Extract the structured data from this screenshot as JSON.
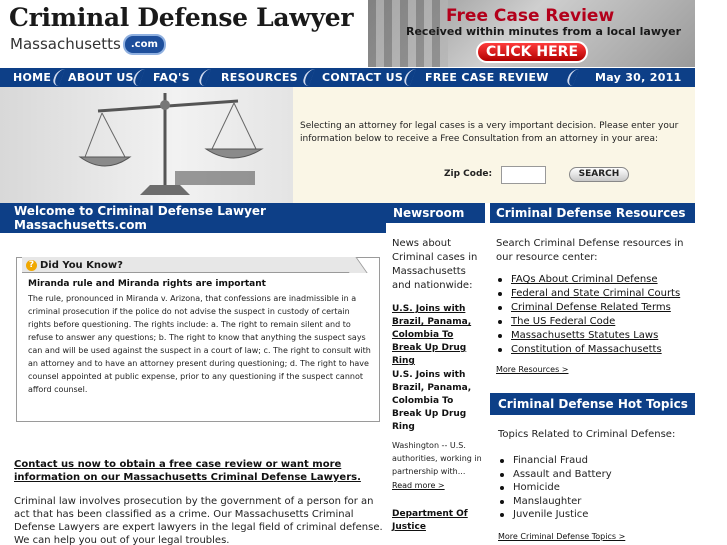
{
  "header": {
    "title": "Criminal Defense Lawyer",
    "subtitle": "Massachusetts",
    "subtitle_badge": ".com"
  },
  "banner": {
    "title": "Free Case Review",
    "subtitle": "Received within minutes from a local lawyer",
    "button": "CLICK HERE"
  },
  "nav": {
    "items": [
      "HOME",
      "ABOUT US",
      "FAQ'S",
      "RESOURCES",
      "CONTACT US",
      "FREE CASE REVIEW"
    ],
    "date": "May 30, 2011"
  },
  "hero": {
    "text": "Selecting an attorney for legal cases is a very important decision. Please enter your information below to receive a Free Consultation from an attorney in your area:",
    "zip_label": "Zip Code:",
    "zip_value": "",
    "search_button": "SEARCH"
  },
  "welcome": {
    "title_line1": "Welcome to Criminal Defense Lawyer",
    "title_line2": "Massachusetts.com"
  },
  "did_you_know": {
    "title": "Did You Know?",
    "icon": "?",
    "heading": "Miranda rule and Miranda rights are important",
    "body": "The rule, pronounced in Miranda v. Arizona, that confessions are inadmissible in a criminal prosecution if the police do not advise the suspect in custody of certain rights before questioning. The rights include: a. The right to remain silent and to refuse to answer any questions; b. The right to know that anything the suspect says can and will be used against the suspect in a court of law; c. The right to consult with an attorney and to have an attorney present during questioning; d. The right to have counsel appointed at public expense, prior to any questioning if the suspect cannot afford counsel."
  },
  "contact": {
    "link": "Contact us now to obtain a free case review or want more information on our Massachusetts Criminal Defense Lawyers.",
    "intro": "Criminal law involves prosecution by the government of a person for an act that has been classified as a crime. Our Massachusetts Criminal Defense Lawyers are expert lawyers in the legal field of criminal defense. We can help you out of your legal troubles."
  },
  "newsroom": {
    "title": "Newsroom",
    "intro": "News about Criminal cases in Massachusetts and nationwide:",
    "items": [
      {
        "link": "U.S. Joins with Brazil, Panama, Colombia To Break Up Drug Ring",
        "title": "U.S. Joins with Brazil, Panama, Colombia To Break Up Drug Ring",
        "desc": "Washington -- U.S. authorities, working in partnership with...",
        "more": "Read more >"
      },
      {
        "link": "Department Of Justice"
      }
    ]
  },
  "resources": {
    "title": "Criminal Defense Resources",
    "intro": "Search Criminal Defense resources in our resource center:",
    "links": [
      "FAQs About Criminal Defense",
      "Federal and State Criminal Courts",
      "Criminal Defense Related Terms",
      "The US Federal Code",
      "Massachusetts Statutes Laws",
      "Constitution of Massachusetts"
    ],
    "more": "More Resources >"
  },
  "hot_topics": {
    "title": "Criminal Defense Hot Topics",
    "intro": "Topics Related to Criminal Defense:",
    "items": [
      "Financial Fraud",
      "Assault and Battery",
      "Homicide",
      "Manslaughter",
      "Juvenile Justice"
    ],
    "more": "More Criminal Defense Topics >"
  }
}
